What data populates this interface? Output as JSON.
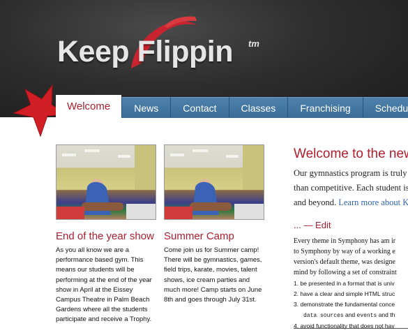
{
  "brand": {
    "name": "Keep Flippin",
    "trademark": "tm"
  },
  "nav": {
    "tabs": [
      "Welcome",
      "News",
      "Contact",
      "Classes",
      "Franchising",
      "Schedule"
    ]
  },
  "colors": {
    "accent_red": "#b11d2c",
    "nav_blue": "#3f719b",
    "header_dark": "#262626",
    "link_blue": "#2f64b3"
  },
  "articles": [
    {
      "title": "End of the year show",
      "body": "As you all know we are a performance based gym. This means our students will be performing at the end of the year show in April at the Eissey Campus Theatre in Palm Beach Gardens where all the students participate and receive a Trophy."
    },
    {
      "title": "Summer Camp",
      "body": "Come join us for Summer camp! There will be gymnastics, games, field trips, karate, movies, talent shows, ice cream parties and much more! Camp starts on June 8th and goes through July 31st."
    }
  ],
  "main": {
    "heading": "Welcome to the new",
    "intro_lines": [
      "Our gymnastics program is truly",
      "than competitive. Each student is",
      "and beyond."
    ],
    "learn_more": "Learn more about K",
    "subheading": "... — Edit",
    "body_lines": [
      "Every theme in Symphony has am ir",
      "to Symphony by way of a working e",
      "version's default theme, was designe",
      "mind by following a set of constraint"
    ],
    "list_items": [
      {
        "num": "1.",
        "text": "be presented in a format that is univ"
      },
      {
        "num": "2.",
        "text": "have a clear and simple HTML struc"
      },
      {
        "num": "3.",
        "text": "demonstrate the fundamental conce"
      },
      {
        "num": "",
        "code1": "data sources",
        "mid": " and ",
        "code2": "events",
        "tail": " and th"
      },
      {
        "num": "4.",
        "text": "avoid functionality that does not hav"
      }
    ]
  }
}
